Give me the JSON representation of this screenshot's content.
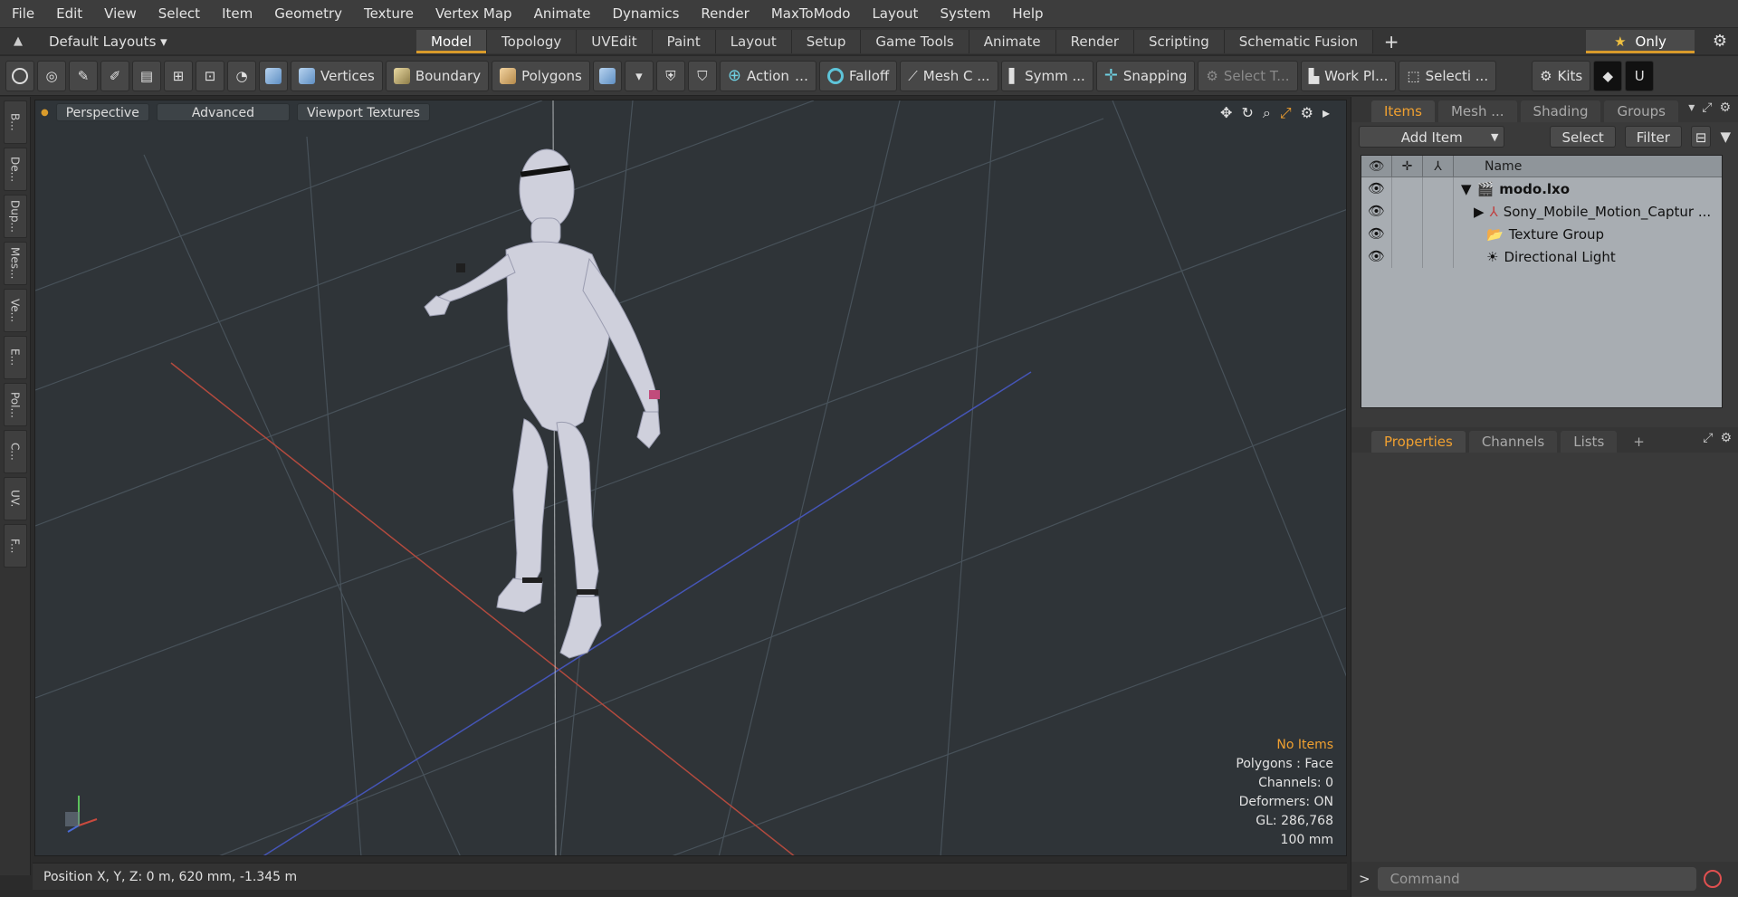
{
  "menu": [
    "File",
    "Edit",
    "View",
    "Select",
    "Item",
    "Geometry",
    "Texture",
    "Vertex Map",
    "Animate",
    "Dynamics",
    "Render",
    "MaxToModo",
    "Layout",
    "System",
    "Help"
  ],
  "layout_bar": {
    "default_layouts": "Default Layouts ▾",
    "tabs": [
      "Model",
      "Topology",
      "UVEdit",
      "Paint",
      "Layout",
      "Setup",
      "Game Tools",
      "Animate",
      "Render",
      "Scripting",
      "Schematic Fusion"
    ],
    "active_tab": "Model",
    "only_label": "Only"
  },
  "toolbar": {
    "vertices": "Vertices",
    "boundary": "Boundary",
    "polygons": "Polygons",
    "action": "Action",
    "falloff": "Falloff",
    "mesh": "Mesh C ...",
    "symm": "Symm ...",
    "snapping": "Snapping",
    "select_t": "Select T...",
    "work_pl": "Work Pl...",
    "selecti": "Selecti ...",
    "kits": "Kits"
  },
  "left_rail": [
    "B...",
    "De...",
    "Dup...",
    "Mes...",
    "Ve...",
    "E...",
    "Pol...",
    "C...",
    "UV.",
    "F..."
  ],
  "viewport": {
    "perspective": "Perspective",
    "advanced": "Advanced",
    "viewport_textures": "Viewport Textures",
    "stats": {
      "no_items": "No Items",
      "polygons": "Polygons : Face",
      "channels": "Channels: 0",
      "deformers": "Deformers: ON",
      "gl": "GL: 286,768",
      "scale": "100 mm"
    }
  },
  "status": {
    "position": "Position X, Y, Z:   0 m, 620 mm, -1.345 m"
  },
  "items_panel": {
    "tabs": [
      "Items",
      "Mesh ...",
      "Shading",
      "Groups"
    ],
    "active_tab": "Items",
    "add_item": "Add Item",
    "select": "Select",
    "filter": "Filter",
    "name_header": "Name",
    "rows": [
      {
        "label": "modo.lxo",
        "icon": "clapper-icon"
      },
      {
        "label": "Sony_Mobile_Motion_Captur ...",
        "icon": "locator-icon"
      },
      {
        "label": "Texture Group",
        "icon": "folder-icon"
      },
      {
        "label": "Directional Light",
        "icon": "light-icon"
      }
    ]
  },
  "properties_panel": {
    "tabs": [
      "Properties",
      "Channels",
      "Lists"
    ],
    "active_tab": "Properties"
  },
  "command": {
    "placeholder": "Command"
  },
  "colors": {
    "accent": "#d99b2b",
    "viewport_bg": "#2f3438",
    "model": "#cfd0dc"
  }
}
